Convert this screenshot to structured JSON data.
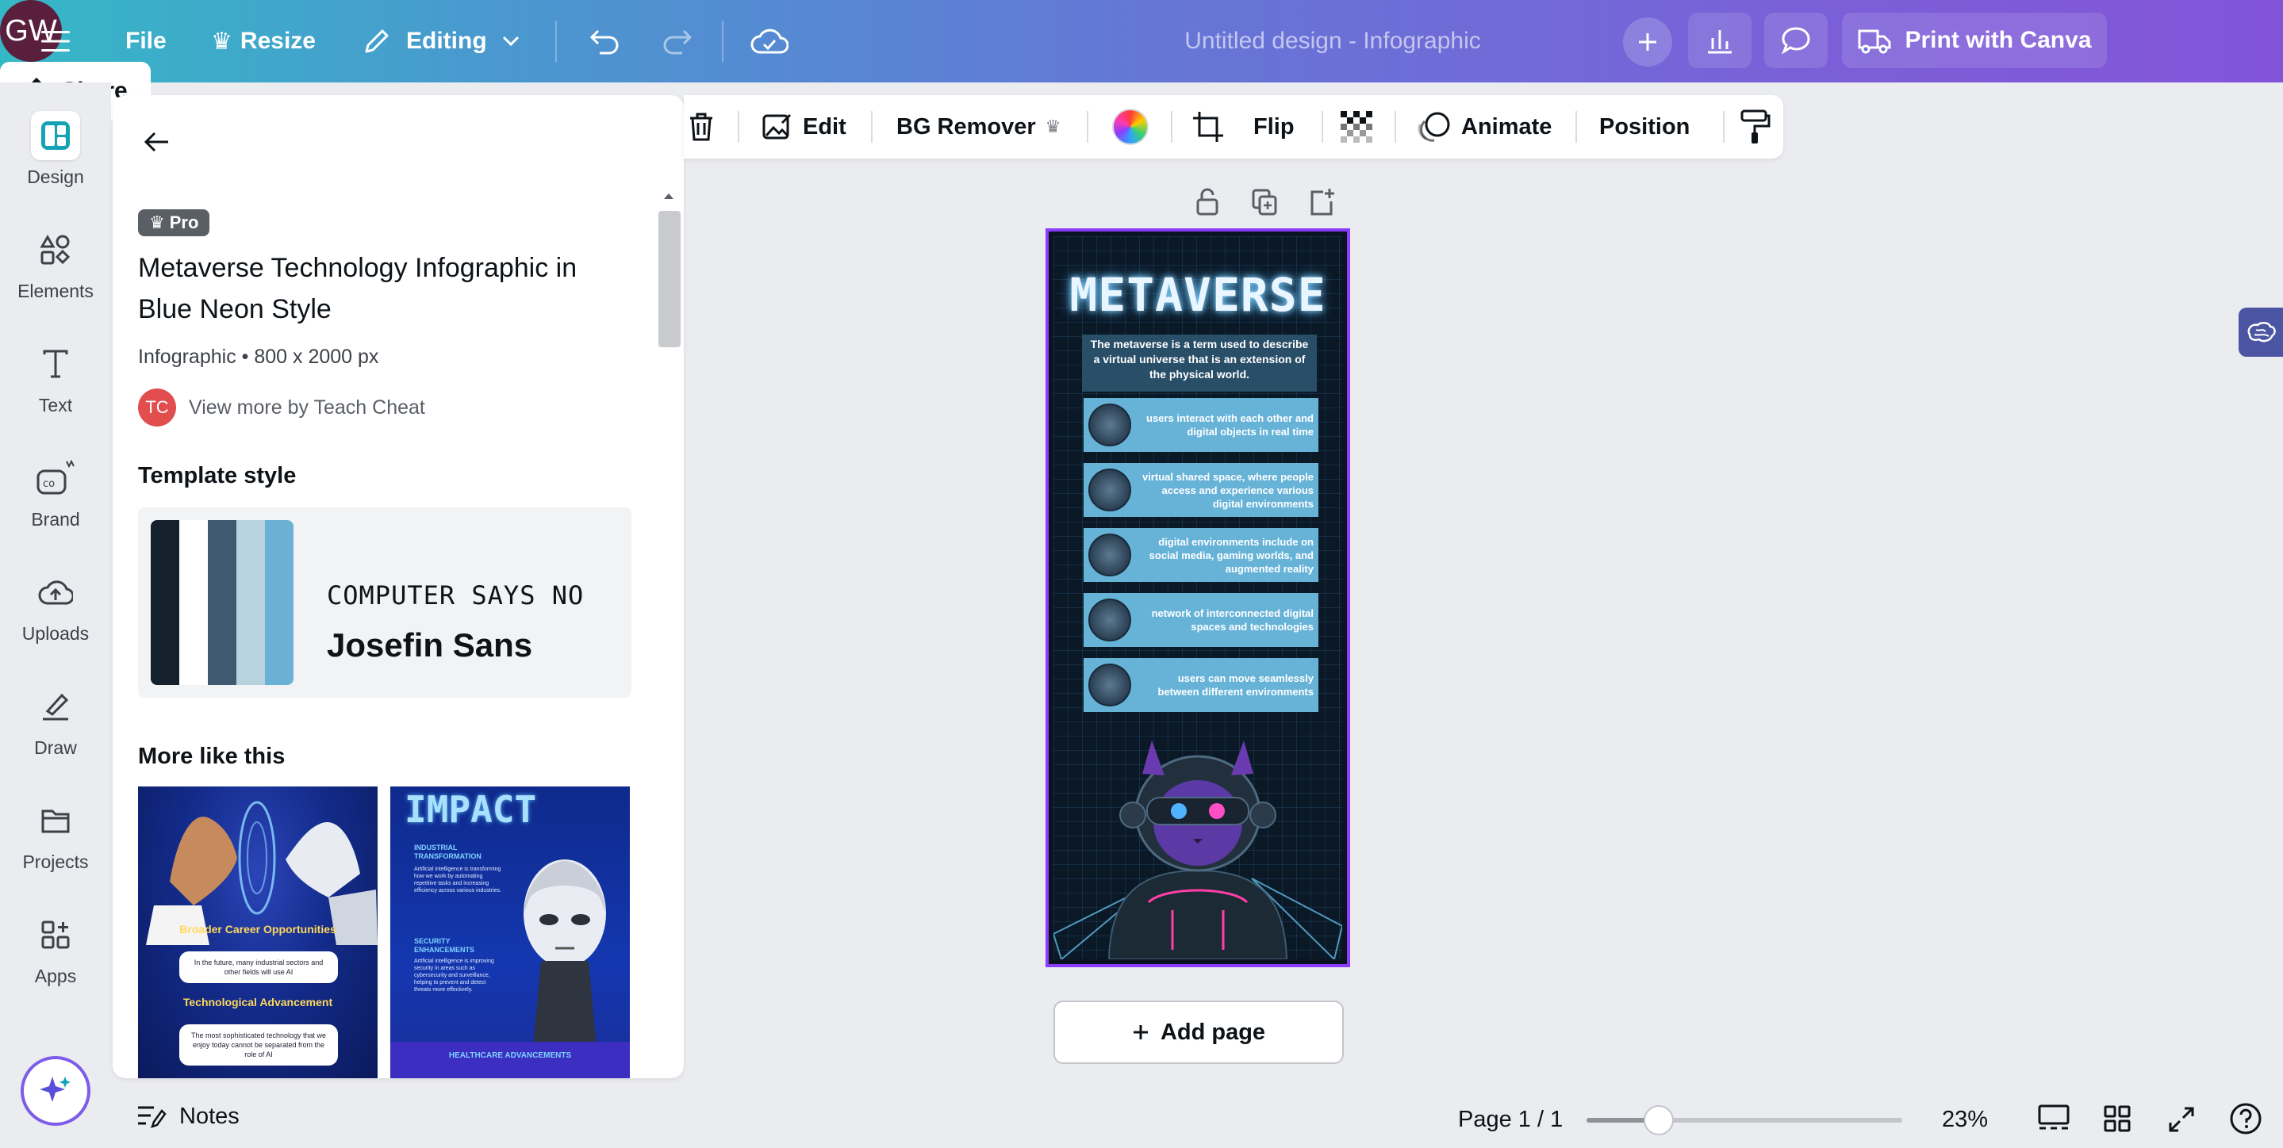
{
  "topbar": {
    "file_label": "File",
    "resize_label": "Resize",
    "editing_label": "Editing",
    "doc_title": "Untitled design - Infographic",
    "avatar_initials": "GW",
    "print_label": "Print with Canva",
    "share_label": "Share"
  },
  "rail": {
    "items": [
      {
        "label": "Design",
        "icon": "design-icon"
      },
      {
        "label": "Elements",
        "icon": "elements-icon"
      },
      {
        "label": "Text",
        "icon": "text-icon"
      },
      {
        "label": "Brand",
        "icon": "brand-icon"
      },
      {
        "label": "Uploads",
        "icon": "uploads-icon"
      },
      {
        "label": "Draw",
        "icon": "draw-icon"
      },
      {
        "label": "Projects",
        "icon": "projects-icon"
      },
      {
        "label": "Apps",
        "icon": "apps-icon"
      }
    ]
  },
  "panel": {
    "badge": "Pro",
    "title": "Metaverse Technology Infographic in Blue Neon Style",
    "meta": "Infographic • 800 x 2000 px",
    "author_initials": "TC",
    "author_link": "View more by Teach Cheat",
    "template_style_heading": "Template style",
    "palette": [
      "#14202c",
      "#ffffff",
      "#3f5a70",
      "#b8d3df",
      "#6bb1d6"
    ],
    "font_heading": "COMPUTER SAYS NO",
    "font_body": "Josefin Sans",
    "more_heading": "More like this",
    "thumb1": {
      "head1": "Broader Career Opportunities",
      "text1": "In the future, many industrial sectors and other fields will use AI",
      "head2": "Technological Advancement",
      "text2": "The most sophisticated technology that we enjoy today cannot be separated from the role of AI"
    },
    "thumb2": {
      "title": "IMPACT",
      "head1": "INDUSTRIAL TRANSFORMATION",
      "text1": "Artificial intelligence is transforming how we work by automating repetitive tasks and increasing efficiency across various industries.",
      "head2": "SECURITY ENHANCEMENTS",
      "text2": "Artificial intelligence is improving security in areas such as cybersecurity and surveillance, helping to prevent and detect threats more effectively.",
      "footer": "HEALTHCARE ADVANCEMENTS"
    }
  },
  "context_toolbar": {
    "edit_label": "Edit",
    "bg_remover_label": "BG Remover",
    "flip_label": "Flip",
    "animate_label": "Animate",
    "position_label": "Position"
  },
  "canvas": {
    "title": "METAVERSE",
    "intro": "The metaverse is a term used to describe a virtual universe that is an extension of the physical world.",
    "rows": [
      "users interact with each other and digital objects in real time",
      "virtual shared space, where people access and experience various digital environments",
      "digital environments include on social media, gaming worlds, and augmented reality",
      "network of interconnected digital spaces and technologies",
      "users can move seamlessly between different environments"
    ],
    "add_page_label": "Add page"
  },
  "bottombar": {
    "notes_label": "Notes",
    "page_indicator": "Page 1 / 1",
    "zoom_value": 23,
    "zoom_label": "23%"
  },
  "colors": {
    "accent": "#8b3dff",
    "gradient_start": "#35b8c6",
    "gradient_end": "#8354d8"
  }
}
